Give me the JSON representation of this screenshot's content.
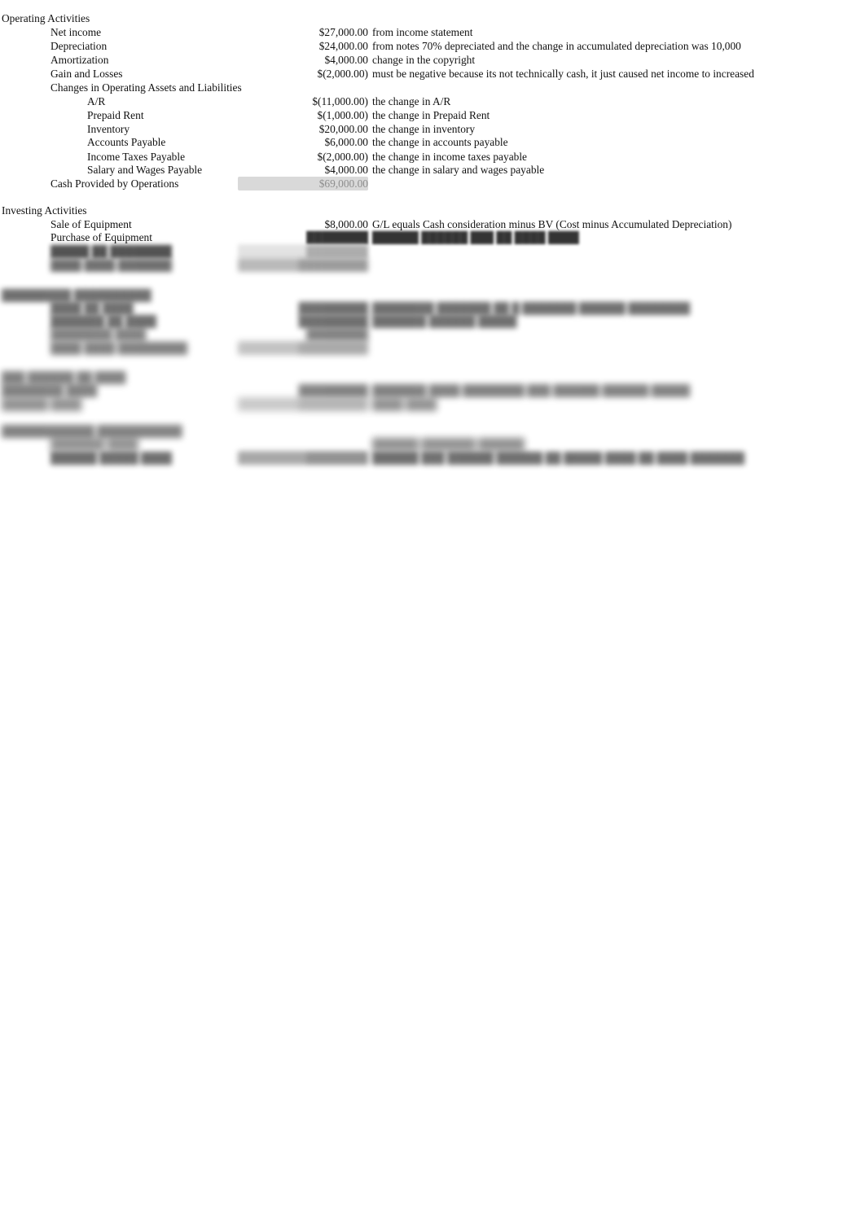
{
  "document": {
    "title": "Statement of Cash Flows",
    "background_color": "#ffffff",
    "text_color": "#111111"
  },
  "sections": [
    {
      "name": "operating-activities",
      "heading": "Operating Activities",
      "rows": [
        {
          "label": "Net income",
          "amount": "$27,000.00",
          "note": "from income statement"
        },
        {
          "label": "Depreciation",
          "amount": "$24,000.00",
          "note": "from notes 70% depreciated and the change in accumulated depreciation was 10,000"
        },
        {
          "label": "Amortization",
          "amount": "$4,000.00",
          "note": "change in the copyright"
        },
        {
          "label": "Gain and Losses",
          "amount": "$(2,000.00)",
          "note": "must be negative because its not technically cash, it just caused net income to increased"
        },
        {
          "label": "Changes in Operating Assets and Liabilities",
          "amount": "",
          "note": ""
        },
        {
          "label": "A/R",
          "amount": "$(11,000.00)",
          "note": "the change in A/R"
        },
        {
          "label": "Prepaid Rent",
          "amount": "$(1,000.00)",
          "note": "the change in Prepaid Rent"
        },
        {
          "label": "Inventory",
          "amount": "$20,000.00",
          "note": "the change in inventory"
        },
        {
          "label": "Accounts Payable",
          "amount": "$6,000.00",
          "note": "the change in accounts payable"
        },
        {
          "label": "Income Taxes Payable",
          "amount": "$(2,000.00)",
          "note": "the change in income taxes payable"
        },
        {
          "label": "Salary and Wages Payable",
          "amount": "$4,000.00",
          "note": "the change in salary and wages payable"
        },
        {
          "label": "Cash Provided by Operations",
          "amount": "$69,000.00",
          "note": ""
        }
      ]
    },
    {
      "name": "investing-activities",
      "heading": "Investing Activities",
      "rows": [
        {
          "label": "Sale of Equipment",
          "amount": "$8,000.00",
          "note": "G/L equals Cash consideration minus BV (Cost minus Accumulated Depreciation)"
        },
        {
          "label": "Purchase of Equipment",
          "amount": "",
          "note": ""
        }
      ]
    }
  ],
  "redacted": {
    "description": "Remaining statement content is blurred and illegible in the screenshot.",
    "blocks": [
      {
        "name": "investing-continued",
        "heading": "",
        "rows": [
          {
            "label": "█████ ██ ████████",
            "amount": "████████",
            "note": "██████ ██████ ███ ██ ████ ████"
          },
          {
            "label": "████ ████ ███████",
            "amount": "█████████",
            "note": ""
          }
        ]
      },
      {
        "name": "financing-activities",
        "heading": "█████████ ██████████",
        "rows": [
          {
            "label": "████ ██ ████",
            "amount": "█████████",
            "note": "████████ ███████ ██ █ ███████ ██████ ████████"
          },
          {
            "label": "███████ ██ ████",
            "amount": "█████████",
            "note": "███████ ██████ █████"
          },
          {
            "label": "████████ ████",
            "amount": "████████",
            "note": ""
          },
          {
            "label": "████ ████ █████████",
            "amount": "█████████",
            "note": ""
          }
        ]
      },
      {
        "name": "net-change-in-cash",
        "heading": "███ ██████ ██ ████",
        "rows": [
          {
            "label": "████████ ████",
            "amount": "█████████",
            "note": "███████ ████ ████████ ███ ██████ ██████ █████"
          },
          {
            "label": "██████ ████",
            "amount": "█████████",
            "note": "████ ████"
          }
        ]
      },
      {
        "name": "supplemental-disclosures",
        "heading": "████████████ ███████████",
        "rows": [
          {
            "label": "███████ ████",
            "amount": "",
            "note": "██████ ███████ ██████"
          },
          {
            "label": "██████ █████ ████",
            "amount": "████████",
            "note": "██████ ███ ██████ ██████ ██ █████ ████ ██ ████ ███████"
          }
        ]
      }
    ]
  }
}
